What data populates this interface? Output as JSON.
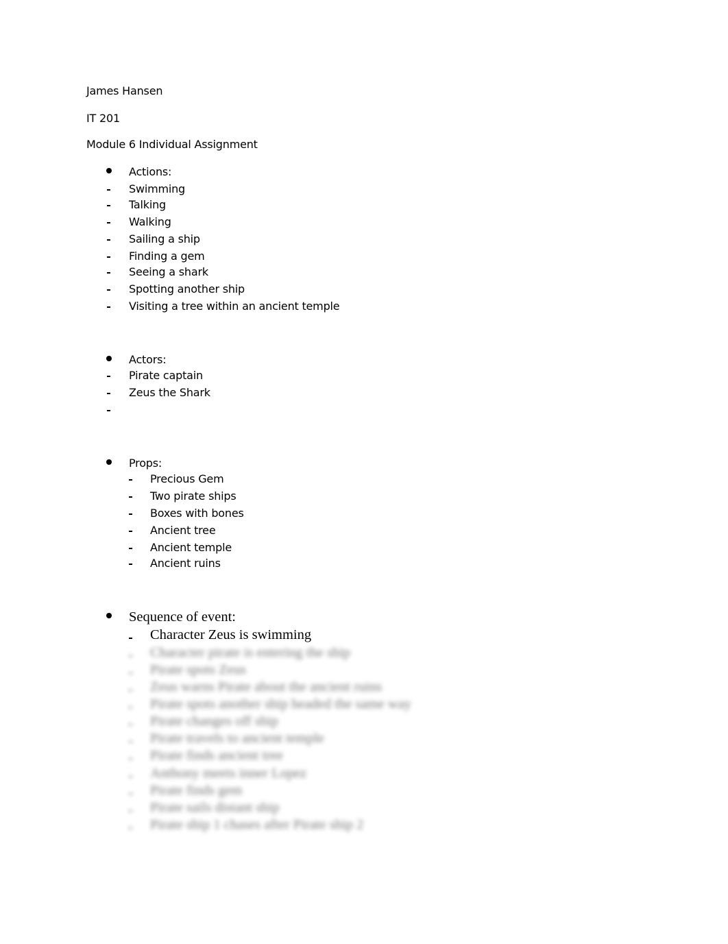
{
  "header": {
    "author": "James Hansen",
    "course": "IT 201",
    "assignment": "Module 6 Individual Assignment"
  },
  "sections": {
    "actions": {
      "heading": "Actions:",
      "items": [
        "Swimming",
        "Talking",
        "Walking",
        "Sailing a ship",
        "Finding a gem",
        "Seeing a shark",
        "Spotting another ship",
        "Visiting a tree within an ancient temple"
      ]
    },
    "actors": {
      "heading": "Actors:",
      "items": [
        "Pirate captain",
        "Zeus the Shark",
        ""
      ]
    },
    "props": {
      "heading": "Props:",
      "items": [
        "Precious Gem",
        "Two pirate ships",
        "Boxes with bones",
        "Ancient tree",
        "Ancient temple",
        "Ancient ruins"
      ]
    },
    "sequence": {
      "heading": "Sequence of event:",
      "items": [
        "Character Zeus is swimming"
      ],
      "blurred_items": [
        "Character pirate is entering the ship",
        "Pirate spots Zeus",
        "Zeus warns Pirate about the ancient ruins",
        "Pirate spots another ship headed the same way",
        "Pirate changes off ship",
        "Pirate travels to ancient temple",
        "Pirate finds ancient tree",
        "Anthony meets inner Lopez",
        "Pirate finds gem",
        "Pirate sails distant ship",
        "Pirate ship 1 chases after Pirate ship 2"
      ]
    }
  }
}
